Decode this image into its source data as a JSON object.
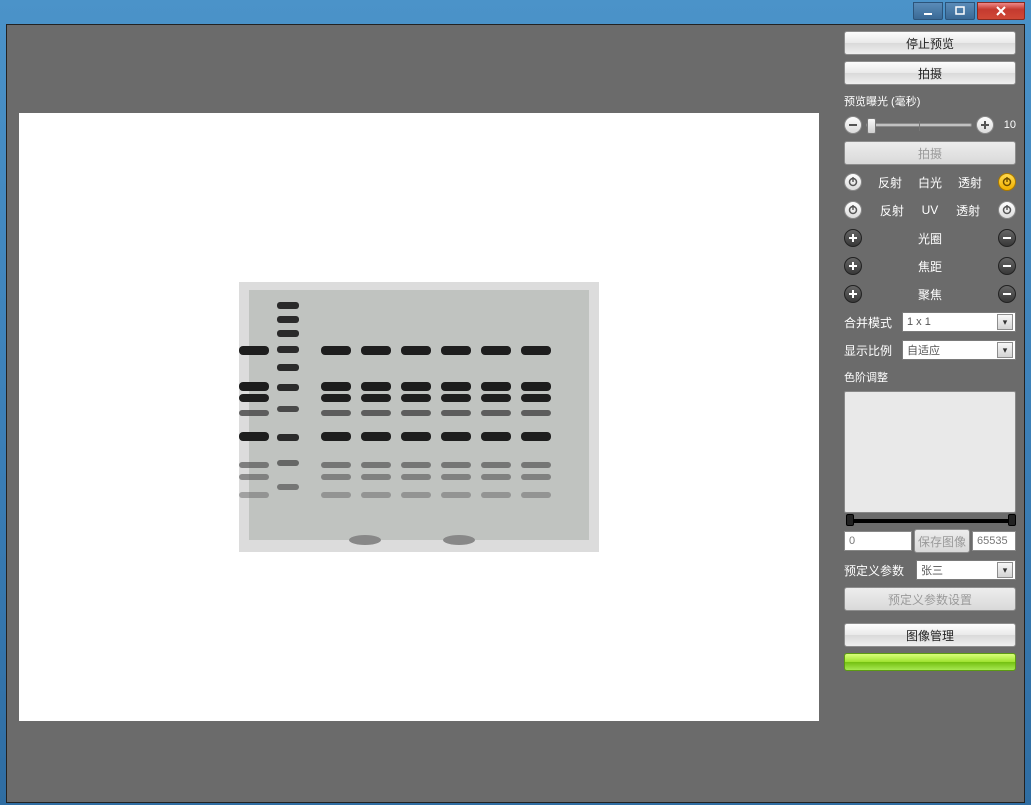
{
  "sidebar": {
    "stop_preview": "停止预览",
    "capture": "拍摄",
    "exposure_label": "预览曝光 (毫秒)",
    "exposure_value": "10",
    "capture_disabled": "拍摄",
    "light": {
      "reflect": "反射",
      "white": "白光",
      "transmit": "透射",
      "uv": "UV"
    },
    "aperture": "光圈",
    "focal": "焦距",
    "focus": "聚焦",
    "merge_mode": {
      "label": "合并模式",
      "value": "1 x 1"
    },
    "display_scale": {
      "label": "显示比例",
      "value": "自适应"
    },
    "histogram_label": "色阶调整",
    "min_val": "0",
    "max_val": "65535",
    "save_image": "保存图像",
    "preset_label": "预定义参数",
    "preset_value": "张三",
    "preset_settings": "预定义参数设置",
    "image_mgmt": "图像管理"
  }
}
